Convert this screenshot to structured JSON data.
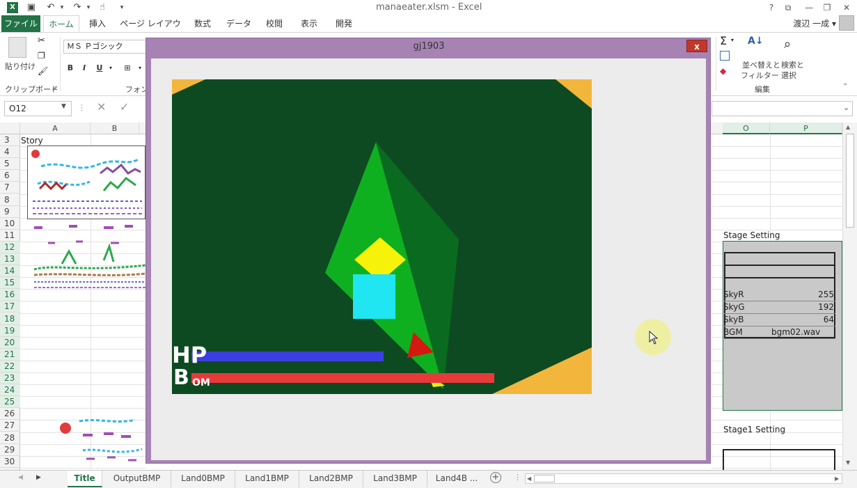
{
  "window": {
    "title": "manaeater.xlsm - Excel",
    "user": "渡辺 一成",
    "buttons": [
      "?",
      "⧉",
      "—",
      "❐",
      "✕"
    ]
  },
  "qat": {
    "logo": "X",
    "save_icon": "💾",
    "undo": "↶",
    "redo": "↷",
    "touch": "☝",
    "more": "▾"
  },
  "ribbon": {
    "tabs": [
      "ファイル",
      "ホーム",
      "挿入",
      "ページ レイアウト",
      "数式",
      "データ",
      "校閲",
      "表示",
      "開発"
    ],
    "clipboard": {
      "paste_label": "貼り付け",
      "group_label": "クリップボード"
    },
    "font": {
      "font_name": "ＭＳ Ｐゴシック",
      "bold": "B",
      "italic": "I",
      "underline": "U",
      "group_label": "フォント"
    },
    "editing": {
      "sum_icon": "Σ",
      "sort_label_1": "並べ替えと",
      "sort_label_2": "フィルター",
      "find_label_1": "検索と",
      "find_label_2": "選択",
      "group_label": "編集"
    }
  },
  "formula_bar": {
    "name_box": "O12"
  },
  "columns": [
    {
      "name": "A",
      "selected": false
    },
    {
      "name": "B",
      "selected": false
    },
    {
      "name": "O",
      "selected": true
    },
    {
      "name": "P",
      "selected": true
    }
  ],
  "rows": [
    "3",
    "4",
    "5",
    "6",
    "7",
    "8",
    "9",
    "10",
    "11",
    "12",
    "13",
    "14",
    "15",
    "16",
    "17",
    "18",
    "19",
    "20",
    "21",
    "22",
    "23",
    "24",
    "25",
    "26",
    "27",
    "28",
    "29",
    "30"
  ],
  "cells": {
    "a3": "Story",
    "o11": "Stage Setting",
    "o27": "Stage1  Setting",
    "settings": [
      {
        "key": "SkyR",
        "value": "255"
      },
      {
        "key": "SkyG",
        "value": "192"
      },
      {
        "key": "SkyB",
        "value": "64"
      },
      {
        "key": "BGM",
        "value": "bgm02.wav"
      }
    ]
  },
  "sheets": [
    "Title",
    "OutputBMP",
    "Land0BMP",
    "Land1BMP",
    "Land2BMP",
    "Land3BMP",
    "Land4B ..."
  ],
  "game": {
    "window_title": "gj1903",
    "close_label": "x",
    "hud": {
      "hp_label": "HP",
      "bomb_label_b": "B",
      "bomb_label_om": "OM"
    },
    "hp_fraction": 0.48,
    "bomb_fraction": 0.86,
    "colors": {
      "background": "#0e4a21",
      "hp_bar": "#3b3fe0",
      "bomb_bar": "#e83a3a",
      "corner": "#f3b63c",
      "ship_light": "#0fb020",
      "ship_dark": "#0a6b20",
      "diamond": "#f6f20a",
      "square": "#1fe6f0",
      "arrow": "#d41a10"
    }
  }
}
